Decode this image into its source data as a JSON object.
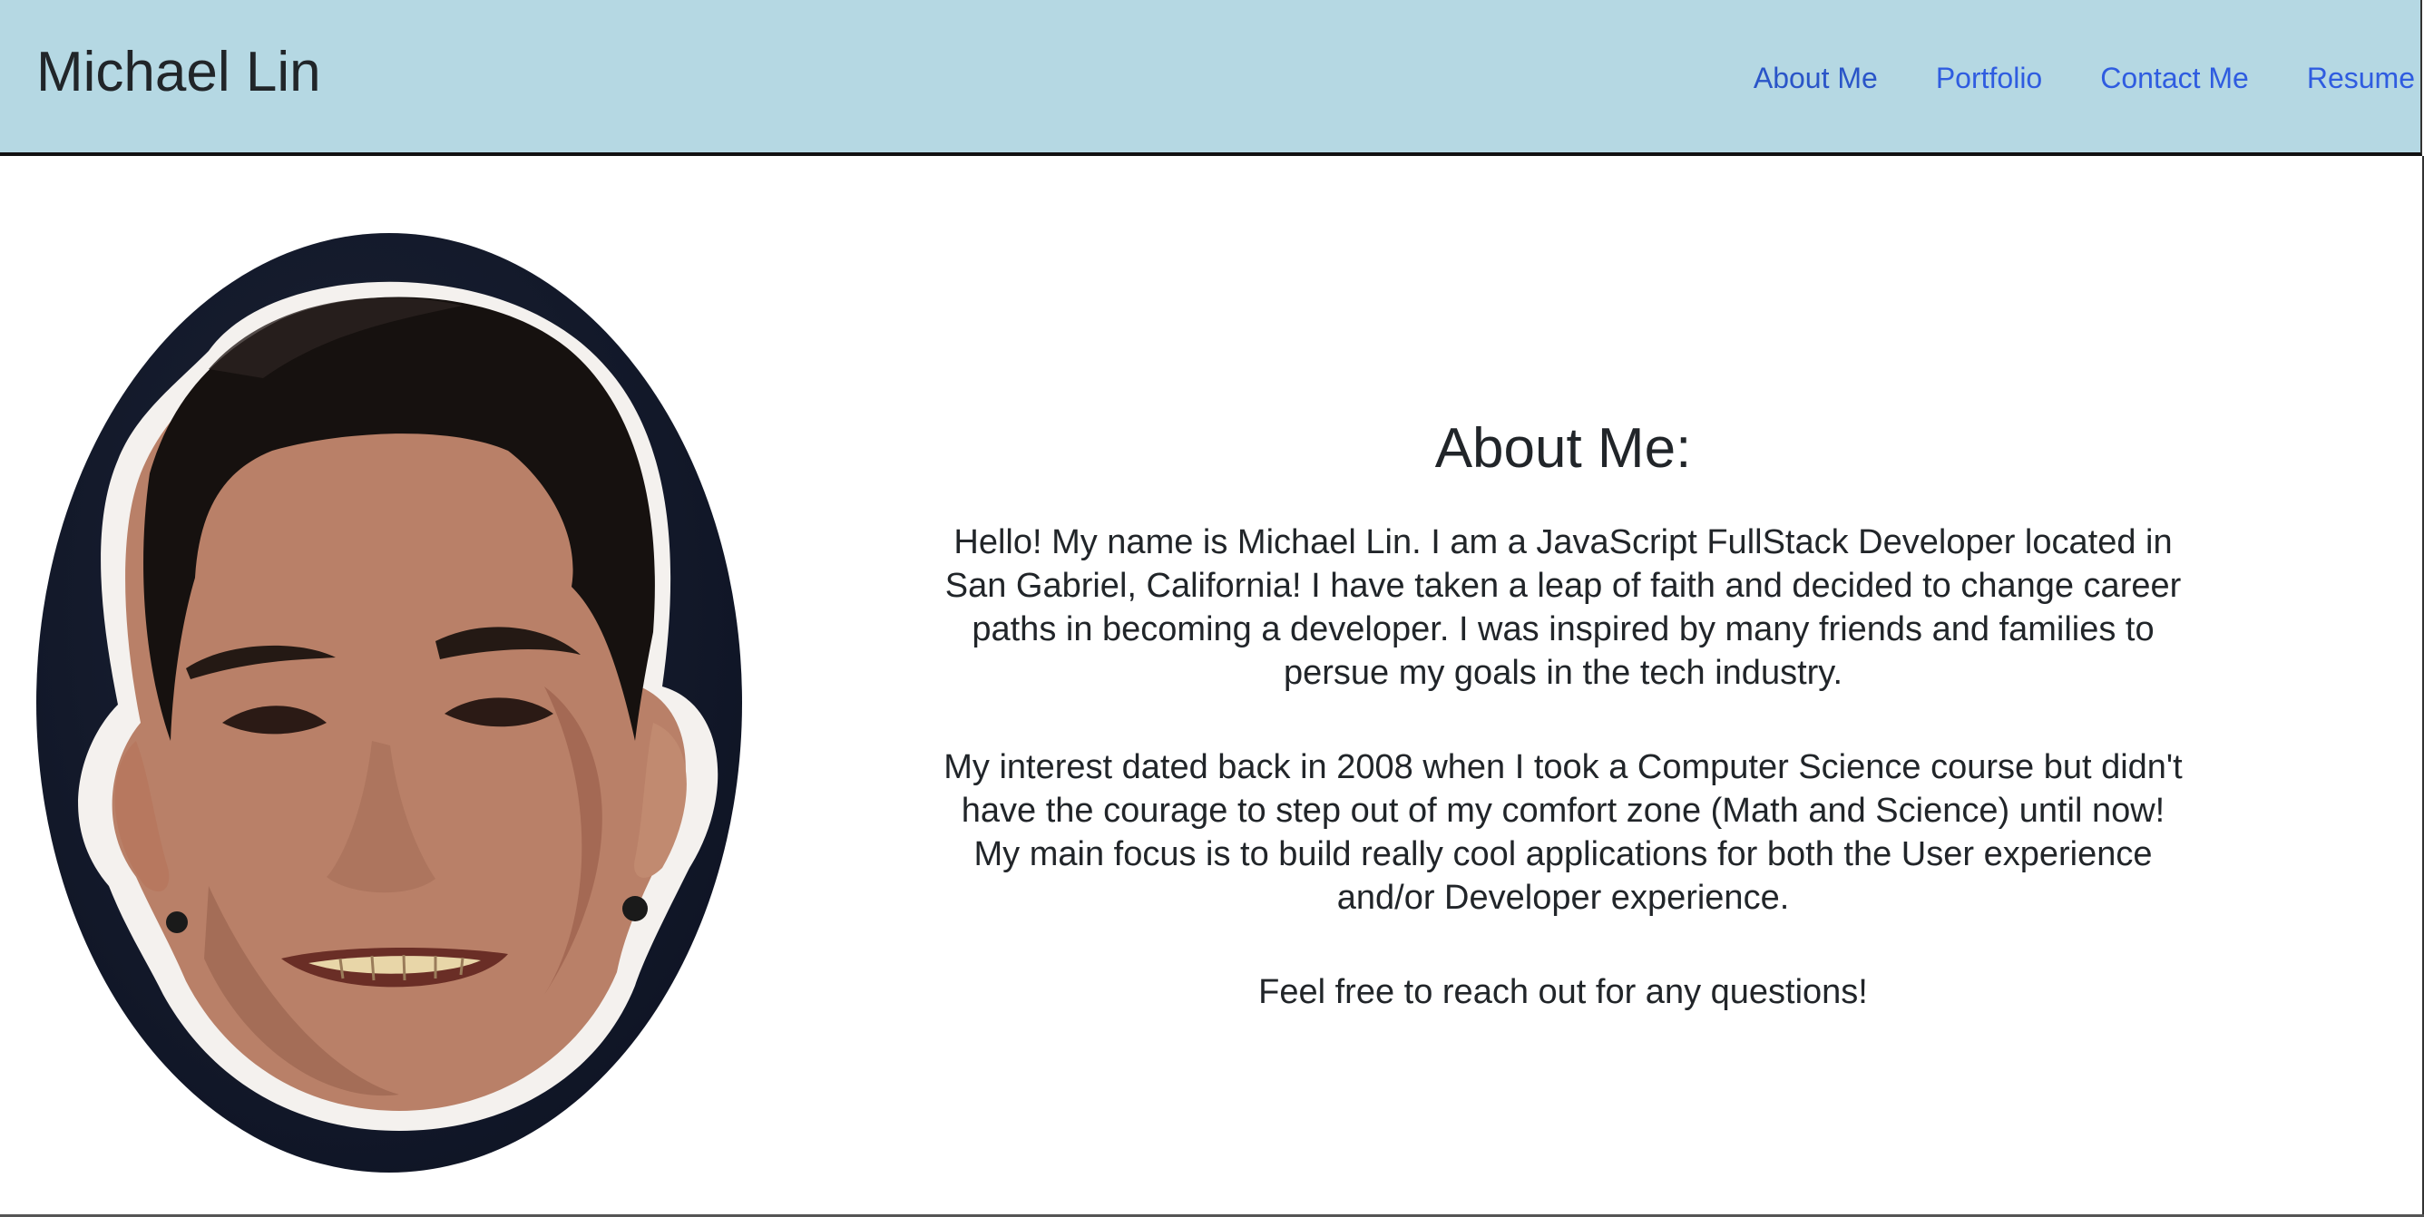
{
  "header": {
    "brand": "Michael Lin",
    "nav": [
      {
        "label": "About Me"
      },
      {
        "label": "Portfolio"
      },
      {
        "label": "Contact Me"
      },
      {
        "label": "Resume"
      }
    ]
  },
  "main": {
    "heading": "About Me:",
    "paragraphs": [
      "Hello! My name is Michael Lin. I am a JavaScript FullStack Developer located in San Gabriel, California! I have taken a leap of faith and decided to change career paths in becoming a developer. I was inspired by many friends and families to persue my goals in the tech industry.",
      "My interest dated back in 2008 when I took a Computer Science course but didn't have the courage to step out of my comfort zone (Math and Science) until now! My main focus is to build really cool applications for both the User experience and/or Developer experience.",
      "Feel free to reach out for any questions!"
    ]
  },
  "colors": {
    "navbar_bg": "#b5d8e3",
    "link": "#2f5ce0",
    "text": "#212529"
  },
  "icons": {
    "profile_photo": "profile-photo"
  }
}
